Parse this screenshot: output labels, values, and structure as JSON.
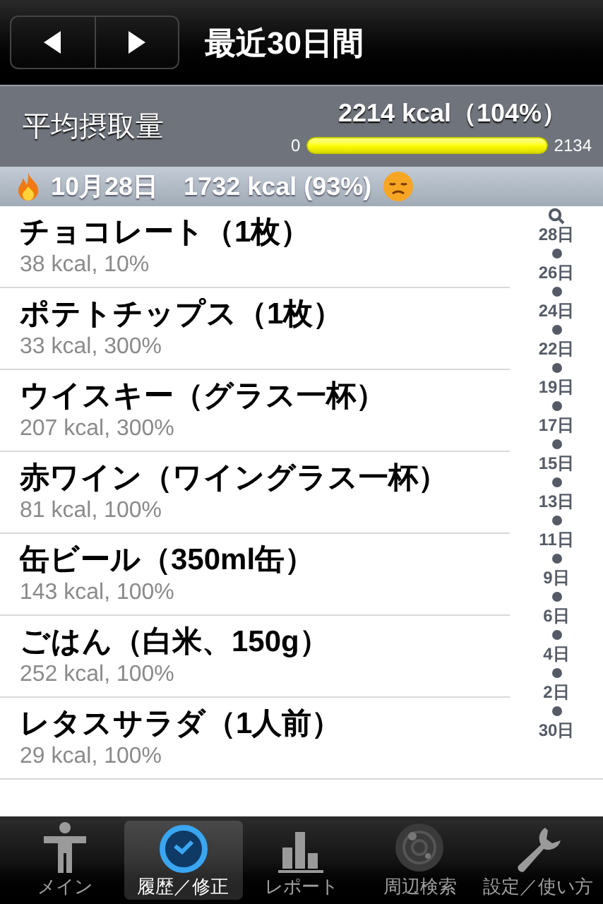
{
  "nav_bar": {
    "title": "最近30日間",
    "buttons": [
      {
        "kind": "prev"
      },
      {
        "kind": "next"
      }
    ]
  },
  "summary": {
    "label": "平均摂取量",
    "value": "2214 kcal（104%）",
    "min": "0",
    "max": "2134",
    "level": 1
  },
  "section_header": {
    "date": "10月28日",
    "total": "1732 kcal (93%)"
  },
  "items": [
    {
      "name": "チョコレート（1枚）",
      "detail": "38 kcal, 10%"
    },
    {
      "name": "ポテトチップス（1枚）",
      "detail": "33 kcal, 300%"
    },
    {
      "name": "ウイスキー（グラス一杯）",
      "detail": "207 kcal, 300%"
    },
    {
      "name": "赤ワイン（ワイングラス一杯）",
      "detail": "81 kcal, 100%"
    },
    {
      "name": "缶ビール（350ml缶）",
      "detail": "143 kcal, 100%"
    },
    {
      "name": "ごはん（白米、150g）",
      "detail": "252 kcal, 100%"
    },
    {
      "name": "レタスサラダ（1人前）",
      "detail": "29 kcal, 100%"
    }
  ],
  "index": [
    "28日",
    "26日",
    "24日",
    "22日",
    "19日",
    "17日",
    "15日",
    "13日",
    "11日",
    "9日",
    "6日",
    "4日",
    "2日",
    "30日"
  ],
  "tab_bar": [
    {
      "label": "メイン",
      "kind": "person",
      "selected": false
    },
    {
      "label": "履歴／修正",
      "kind": "clock",
      "selected": true
    },
    {
      "label": "レポート",
      "kind": "chart",
      "selected": false
    },
    {
      "label": "周辺検索",
      "kind": "radar",
      "selected": false
    },
    {
      "label": "設定／使い方",
      "kind": "wrench",
      "selected": false
    }
  ]
}
